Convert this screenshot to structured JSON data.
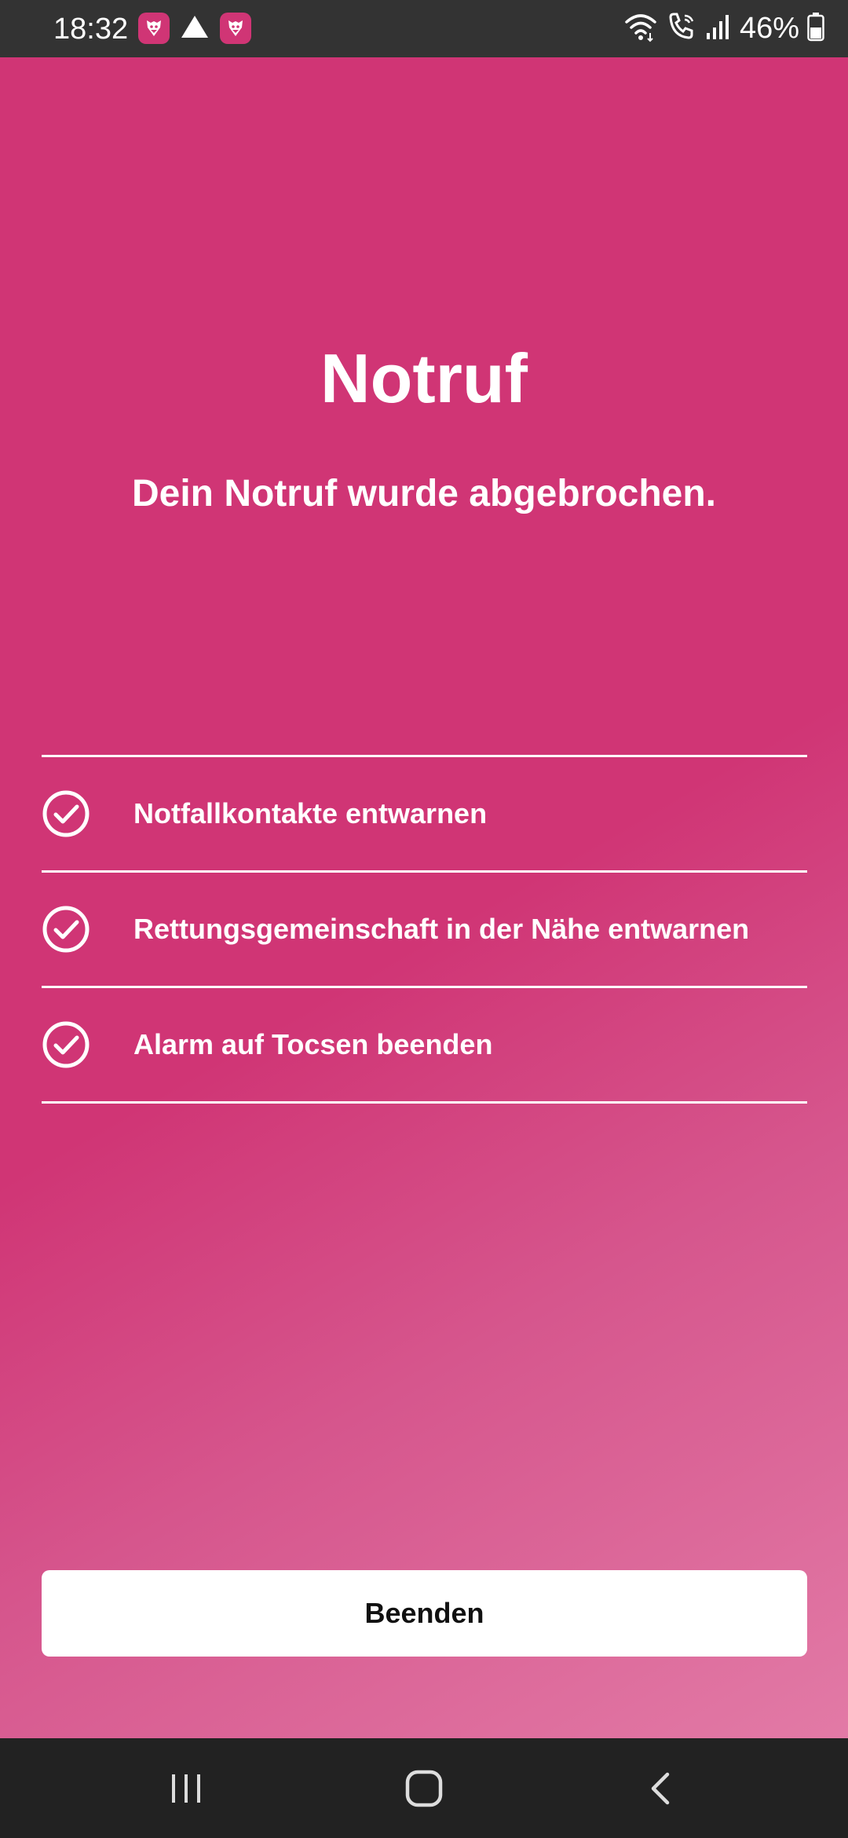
{
  "status_bar": {
    "time": "18:32",
    "battery": "46%",
    "icons": [
      "app-notification-icon",
      "drive-icon",
      "app-notification-icon",
      "wifi-icon",
      "wifi-calling-icon",
      "signal-icon",
      "battery-icon"
    ]
  },
  "main": {
    "title": "Notruf",
    "subtitle": "Dein Notruf wurde abgebrochen.",
    "checklist": [
      {
        "label": "Notfallkontakte entwarnen",
        "icon": "check-circle-icon"
      },
      {
        "label": "Rettungsgemeinschaft in der Nähe entwarnen",
        "icon": "check-circle-icon"
      },
      {
        "label": "Alarm auf Tocsen beenden",
        "icon": "check-circle-icon"
      }
    ],
    "finish_button_label": "Beenden"
  },
  "nav_bar": {
    "buttons": [
      "recent-apps-icon",
      "home-icon",
      "back-icon"
    ]
  },
  "colors": {
    "accent": "#d03575",
    "status_bar": "#333333",
    "nav_bar": "#222222",
    "button_bg": "#ffffff"
  }
}
